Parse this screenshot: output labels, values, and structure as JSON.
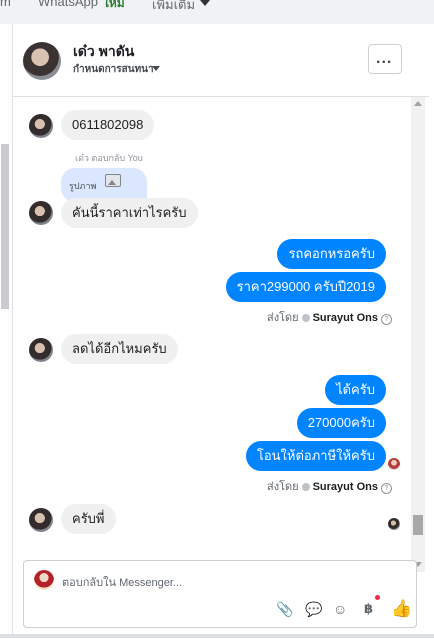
{
  "top_tabs": [
    {
      "label": "m"
    },
    {
      "label": "WhatsApp"
    },
    {
      "label": "ใหม่"
    },
    {
      "label": "เพิ่มเติม"
    }
  ],
  "header": {
    "name": "เด๋ว พาดัน",
    "subtitle": "กำหนดการสนทนา",
    "menu_label": "..."
  },
  "messages": {
    "m1": "0611802098",
    "reply_meta": "เด๋ว ตอบกลับ You",
    "reply_quote": "รูปภาพ",
    "m2": "คันนี้ราคาเท่าไรครับ",
    "o1": "รถคอกหรอครับ",
    "o2": "ราคา299000 ครับปี2019",
    "sent_by_prefix": "ส่งโดย",
    "sent_by_name": "Surayut Ons",
    "m3": "ลดได้อีกไหมครับ",
    "o3": "ได้ครับ",
    "o4": "270000ครับ",
    "o5": "โอนให้ต่อภาษีให้ครับ",
    "m4": "ครับพี่"
  },
  "composer": {
    "placeholder": "ตอบกลับใน Messenger...",
    "icons": [
      "attach-icon",
      "gif-icon",
      "emoji-icon",
      "payment-icon",
      "like-icon"
    ]
  },
  "colors": {
    "accent": "#0084ff",
    "incoming_bubble": "#f1f0f0"
  }
}
